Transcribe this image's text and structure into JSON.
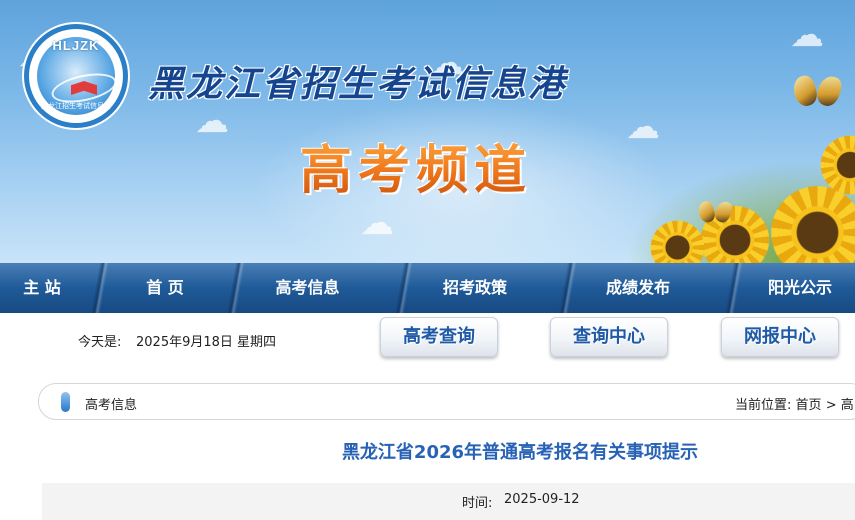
{
  "banner": {
    "logo_caption": "HLJZK",
    "logo_ring_text": "黑龙江招生考试信息港",
    "site_title": "黑龙江省招生考试信息港",
    "channel_title": "高考频道"
  },
  "nav": {
    "items": [
      "主 站",
      "首 页",
      "高考信息",
      "招考政策",
      "成绩发布",
      "阳光公示"
    ]
  },
  "toolbar": {
    "date_label": "今天是:",
    "date_value": "2025年9月18日 星期四",
    "buttons": [
      "高考查询",
      "查询中心",
      "网报中心"
    ]
  },
  "breadcrumb": {
    "section": "高考信息",
    "location_prefix": "当前位置:",
    "home": "首页",
    "separator": ">",
    "current": "高"
  },
  "article": {
    "title": "黑龙江省2026年普通高考报名有关事项提示",
    "time_label": "时间:",
    "time_value": "2025-09-12"
  },
  "colors": {
    "nav_bg": "#1f5a98",
    "title_blue": "#2762b5",
    "channel_orange": "#f07a1e",
    "button_text": "#1f5aa6"
  }
}
